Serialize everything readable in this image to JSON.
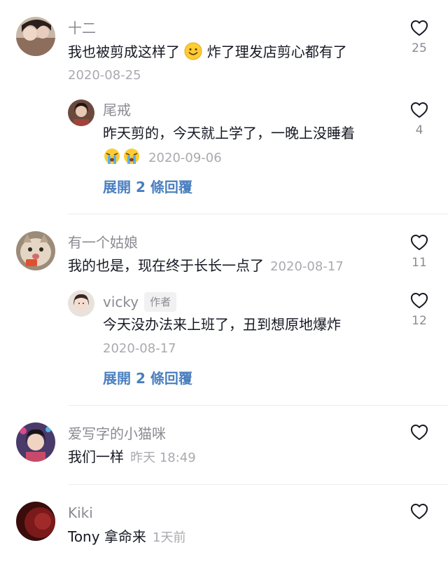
{
  "comments": [
    {
      "username": "十二",
      "text_before_emoji": "我也被剪成这样了",
      "emoji": "smile-emoji",
      "text_after_emoji": "炸了理发店剪心都有了",
      "date": "2020-08-25",
      "likes": "25",
      "replies": [
        {
          "username": "尾戒",
          "text": "昨天剪的，今天就上学了，一晚上没睡着",
          "emoji": "crying-emoji",
          "date": "2020-09-06",
          "likes": "4"
        }
      ],
      "expand_label": "展開 2 條回覆"
    },
    {
      "username": "有一个姑娘",
      "text": "我的也是，现在终于长长一点了",
      "date": "2020-08-17",
      "likes": "11",
      "replies": [
        {
          "username": "vicky",
          "author_tag": "作者",
          "text": "今天没办法来上班了，丑到想原地爆炸",
          "date": "2020-08-17",
          "likes": "12"
        }
      ],
      "expand_label": "展開 2 條回覆"
    },
    {
      "username": "爱写字的小猫咪",
      "text": "我们一样",
      "date": "昨天 18:49"
    },
    {
      "username": "Kiki",
      "text": "Tony 拿命来",
      "date": "1天前"
    }
  ],
  "colors": {
    "link": "#4a7fbf",
    "meta": "#a9aaaf",
    "username": "#8a8b91",
    "text": "#161823"
  }
}
